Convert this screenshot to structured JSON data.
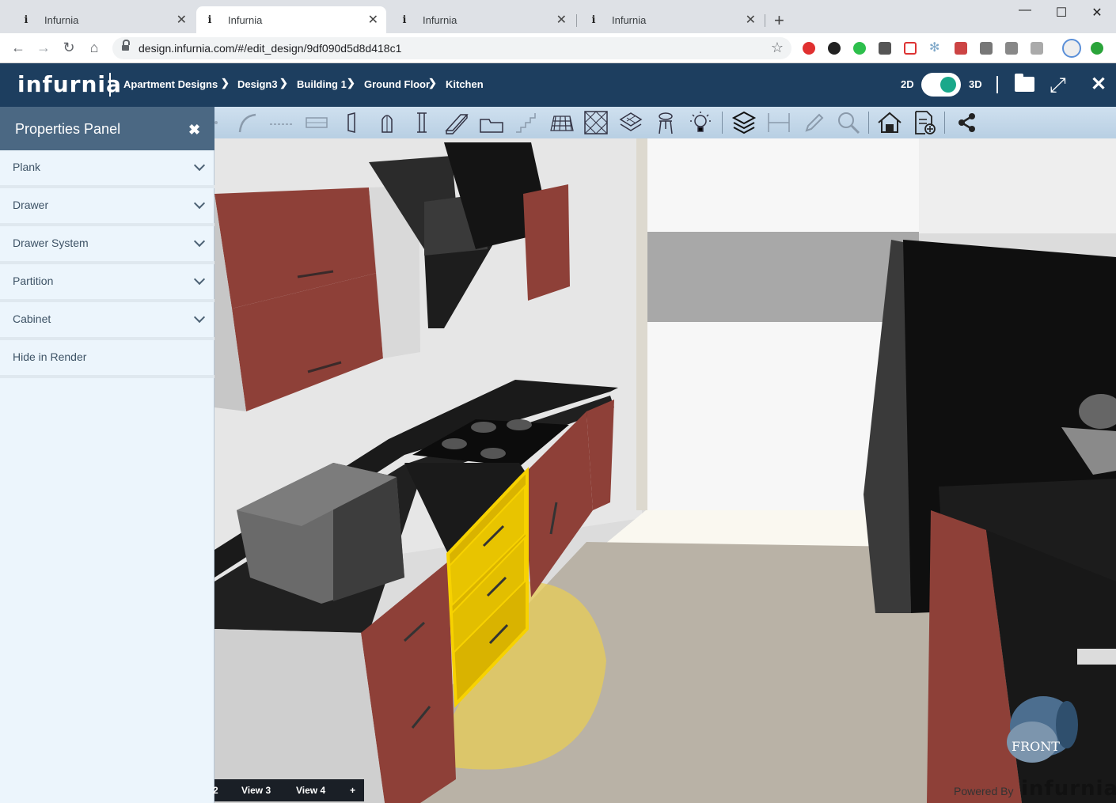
{
  "browser": {
    "tabs": [
      {
        "title": "Infurnia",
        "favicon": "i"
      },
      {
        "title": "Infurnia",
        "favicon": "i"
      },
      {
        "title": "Infurnia",
        "favicon": "i"
      },
      {
        "title": "Infurnia",
        "favicon": "i"
      }
    ],
    "active_tab": 1,
    "url": "design.infurnia.com/#/edit_design/9df090d5d8d418c1",
    "extension_icons": [
      "adblock-icon",
      "camera-icon",
      "whatsapp-icon",
      "monitor-icon",
      "pocket-icon",
      "snowflake-icon",
      "pdf-icon",
      "grammarly-icon",
      "drive-icon",
      "tab-icon",
      "profile-icon",
      "update-icon"
    ]
  },
  "app": {
    "logo": "infurnia",
    "breadcrumbs": [
      "Apartment Designs",
      "Design3",
      "Building 1",
      "Ground Floor",
      "Kitchen"
    ],
    "view_toggle": {
      "left": "2D",
      "right": "3D",
      "selected": "3D"
    },
    "toggle_color": "#1aa88a",
    "header_color": "#1d3e5f"
  },
  "toolbar": {
    "icons": [
      "wall-icon",
      "curve-wall-icon",
      "dashed-line-icon",
      "window-icon",
      "door-icon",
      "arch-door-icon",
      "pillar-icon",
      "beam-icon",
      "floor-icon",
      "stairs-icon",
      "grid-ceiling-icon",
      "pattern-icon",
      "layers-icon",
      "furniture-icon",
      "light-icon",
      "stack-icon",
      "dimension-icon",
      "pencil-icon",
      "zoom-icon",
      "house-icon",
      "add-document-icon",
      "share-icon"
    ]
  },
  "properties_panel": {
    "title": "Properties Panel",
    "sections": [
      {
        "label": "Plank",
        "expandable": true
      },
      {
        "label": "Drawer",
        "expandable": true
      },
      {
        "label": "Drawer System",
        "expandable": true
      },
      {
        "label": "Partition",
        "expandable": true
      },
      {
        "label": "Cabinet",
        "expandable": true
      },
      {
        "label": "Hide in Render",
        "expandable": false
      }
    ]
  },
  "view_tabs": [
    "2",
    "View 3",
    "View 4",
    "+"
  ],
  "gizmo": {
    "label": "FRONT"
  },
  "footer": {
    "powered_by": "Powered By",
    "brand": "infurnia"
  }
}
